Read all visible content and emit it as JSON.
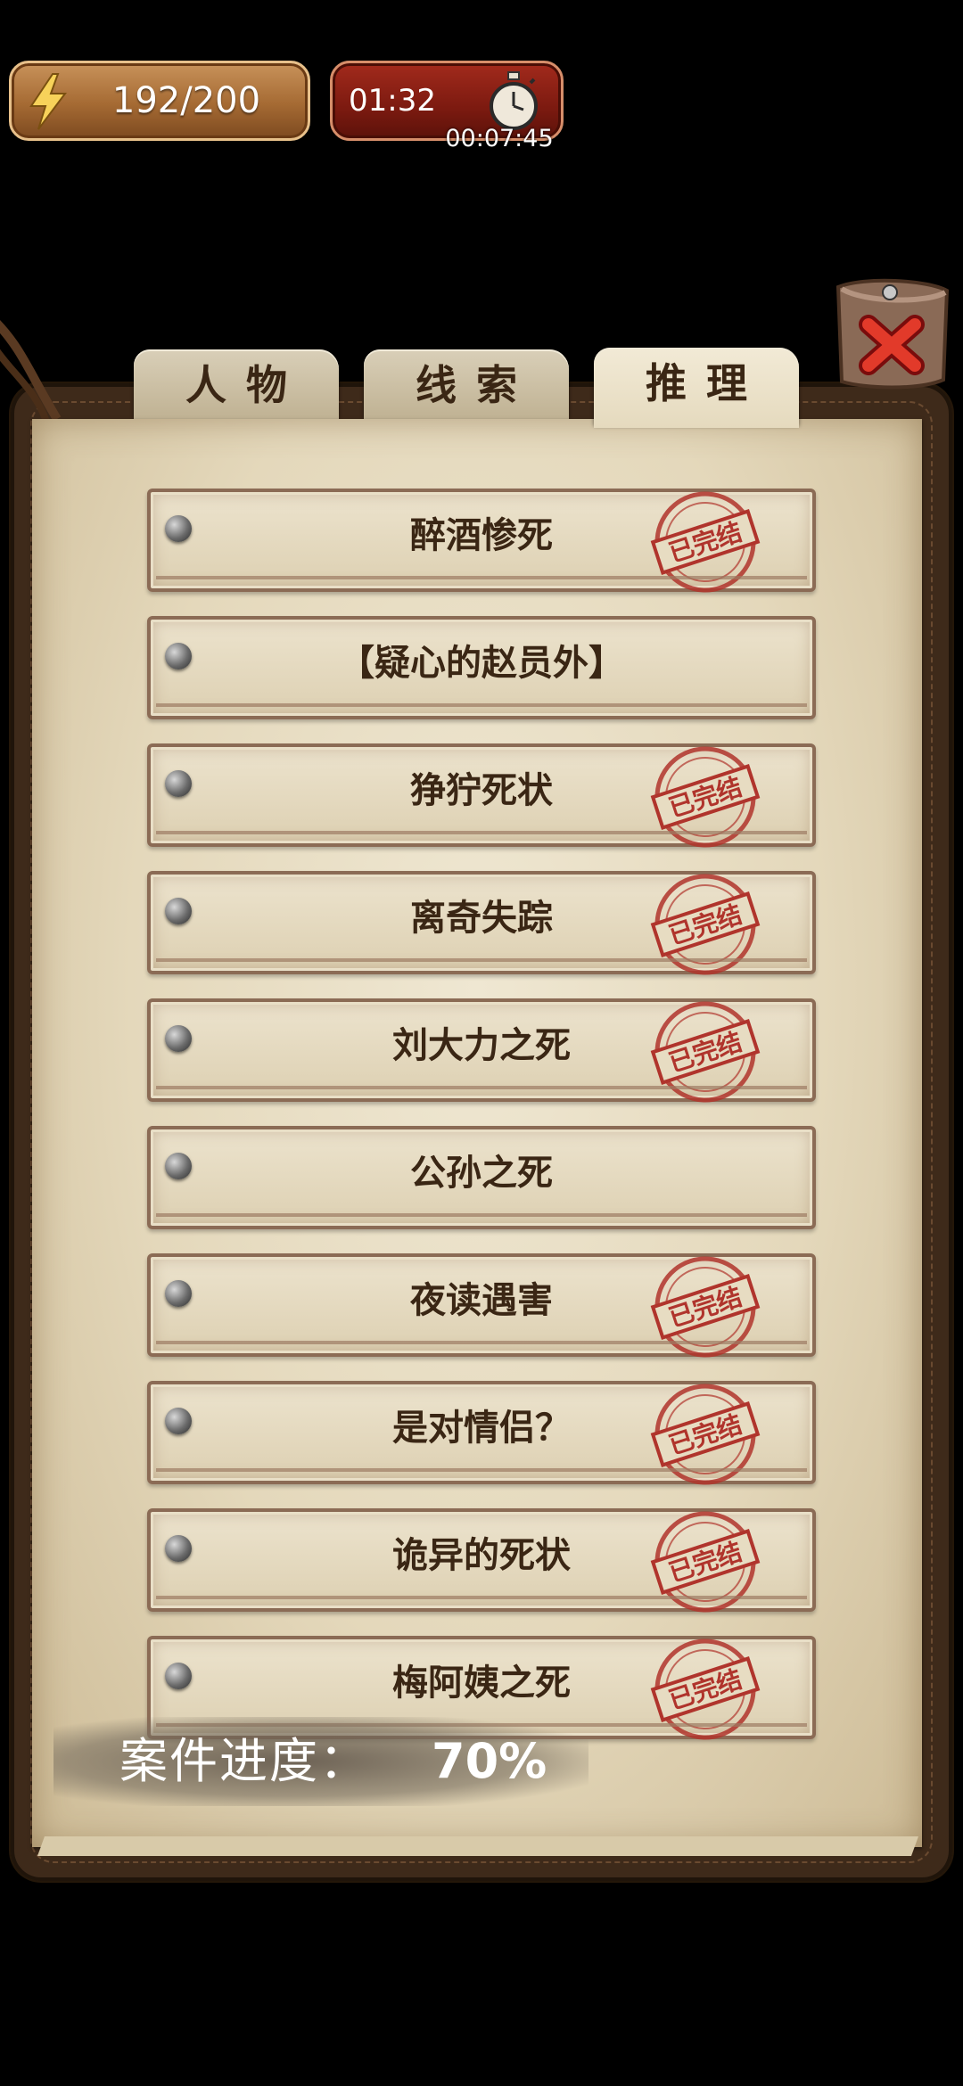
{
  "hud": {
    "energy": "192/200",
    "timer": "01:32",
    "elapsed": "00:07:45"
  },
  "tabs": [
    {
      "label": "人物"
    },
    {
      "label": "线索"
    },
    {
      "label": "推理"
    }
  ],
  "active_tab": "推理",
  "cases": [
    {
      "title": "醉酒惨死",
      "completed": true
    },
    {
      "title": "【疑心的赵员外】",
      "completed": false
    },
    {
      "title": "狰狞死状",
      "completed": true
    },
    {
      "title": "离奇失踪",
      "completed": true
    },
    {
      "title": "刘大力之死",
      "completed": true
    },
    {
      "title": "公孙之死",
      "completed": false
    },
    {
      "title": "夜读遇害",
      "completed": true
    },
    {
      "title": "是对情侣？",
      "completed": true
    },
    {
      "title": "诡异的死状",
      "completed": true
    },
    {
      "title": "梅阿姨之死",
      "completed": true
    }
  ],
  "stamp_text": "已完结",
  "progress": {
    "label": "案件进度：",
    "value": "70%"
  },
  "colors": {
    "stamp_red": "#b0342c",
    "ink_brown": "#3a2614",
    "energy_gold": "#a56a33",
    "timer_red": "#7c1a10"
  }
}
